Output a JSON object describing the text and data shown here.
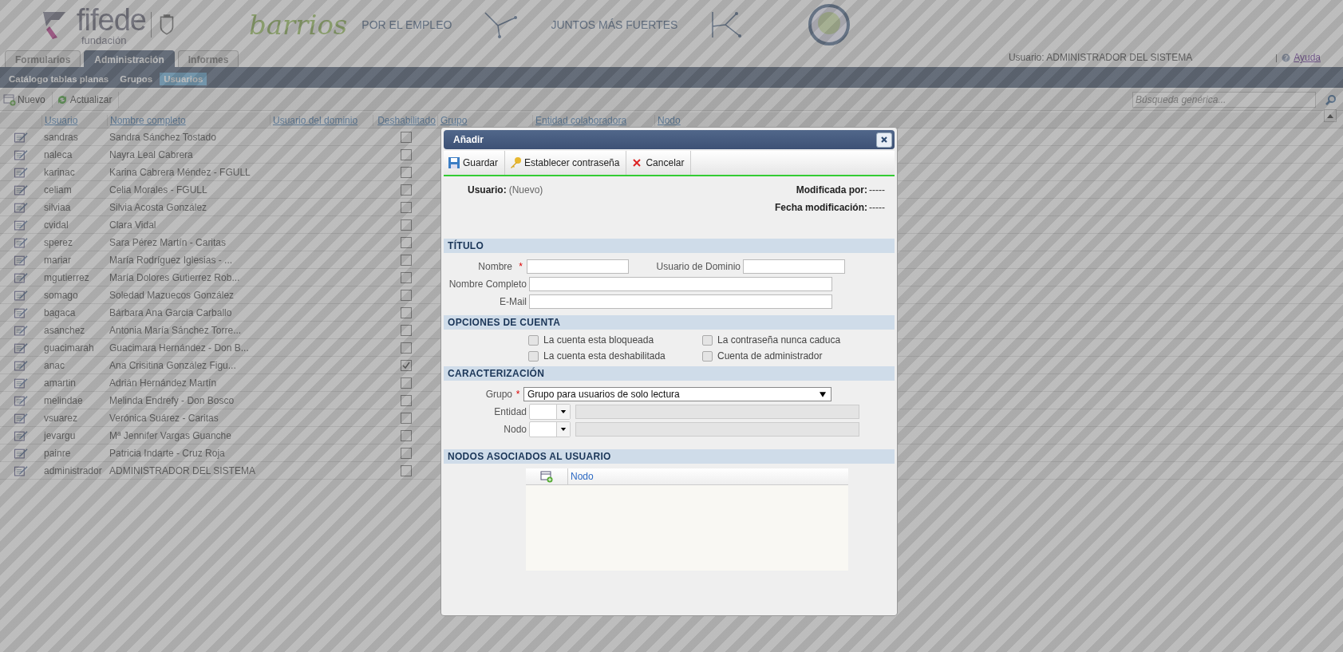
{
  "header": {
    "logo": {
      "name": "fifede",
      "subtitle": "fundación"
    },
    "banner": {
      "script": "barrios",
      "tagline_1": "POR EL EMPLEO",
      "tagline_2": "JUNTOS MÁS FUERTES"
    },
    "user_label": "Usuario: ADMINISTRADOR DEL SISTEMA",
    "help_link": "Ayuda"
  },
  "tabs": [
    {
      "label": "Formularios",
      "selected": false
    },
    {
      "label": "Administración",
      "selected": true
    },
    {
      "label": "Informes",
      "selected": false
    }
  ],
  "subnav": [
    {
      "label": "Catálogo tablas planas",
      "selected": false
    },
    {
      "label": "Grupos",
      "selected": false
    },
    {
      "label": "Usuarios",
      "selected": true
    }
  ],
  "toolbar": {
    "buttons": [
      {
        "kind": "new",
        "label": "Nuevo"
      },
      {
        "kind": "refresh",
        "label": "Actualizar"
      }
    ],
    "search": {
      "placeholder": "Búsqueda genérica..."
    }
  },
  "table": {
    "columns": [
      "Usuario",
      "Nombre completo",
      "Usuario del dominio",
      "Deshabilitado",
      "Grupo",
      "Entidad colaboradora",
      "Nodo"
    ],
    "rows": [
      {
        "usuario": "sandras",
        "nombre": "Sandra Sánchez Tostado",
        "deshabilitado": false
      },
      {
        "usuario": "naleca",
        "nombre": "Nayra Leal Cabrera",
        "deshabilitado": false
      },
      {
        "usuario": "karinac",
        "nombre": "Karina Cabrera Méndez - FGULL",
        "deshabilitado": false
      },
      {
        "usuario": "celiam",
        "nombre": "Celia Morales - FGULL",
        "deshabilitado": false
      },
      {
        "usuario": "silviaa",
        "nombre": "Silvia Acosta González",
        "deshabilitado": false
      },
      {
        "usuario": "cvidal",
        "nombre": "Clara Vidal",
        "deshabilitado": false
      },
      {
        "usuario": "sperez",
        "nombre": "Sara Pérez Martín - Caritas",
        "deshabilitado": false
      },
      {
        "usuario": "mariar",
        "nombre": "María Rodríguez Iglesias - ...",
        "deshabilitado": false
      },
      {
        "usuario": "mgutierrez",
        "nombre": "María Dolores Gutierrez Rob...",
        "deshabilitado": false
      },
      {
        "usuario": "somago",
        "nombre": "Soledad Mazuecos González",
        "deshabilitado": false
      },
      {
        "usuario": "bagaca",
        "nombre": "Bárbara Ana Garcia Carballo",
        "deshabilitado": false
      },
      {
        "usuario": "asanchez",
        "nombre": "Antonia María Sánchez Torre...",
        "deshabilitado": false
      },
      {
        "usuario": "guacimarah",
        "nombre": "Guacimara Hernández - Don B...",
        "deshabilitado": false
      },
      {
        "usuario": "anac",
        "nombre": "Ana Crisitina González Figu...",
        "deshabilitado": true
      },
      {
        "usuario": "amartin",
        "nombre": "Adrián Hernández Martín",
        "deshabilitado": false
      },
      {
        "usuario": "melindae",
        "nombre": "Melinda Endrefy - Don Bosco",
        "deshabilitado": false
      },
      {
        "usuario": "vsuarez",
        "nombre": "Verónica Suárez - Caritas",
        "deshabilitado": false
      },
      {
        "usuario": "jevargu",
        "nombre": "Mª Jennifer Vargas Guanche",
        "deshabilitado": false
      },
      {
        "usuario": "painre",
        "nombre": "Patricia Indarte - Cruz Roja",
        "deshabilitado": false
      },
      {
        "usuario": "administrador",
        "nombre": "ADMINISTRADOR DEL SISTEMA",
        "deshabilitado": false
      }
    ]
  },
  "dialog": {
    "title": "Añadir",
    "buttons": [
      {
        "kind": "save",
        "label": "Guardar"
      },
      {
        "kind": "key",
        "label": "Establecer contraseña"
      },
      {
        "kind": "cancel",
        "label": "Cancelar"
      }
    ],
    "info": {
      "usuario_label": "Usuario:",
      "usuario_value": "(Nuevo)",
      "modificada_label": "Modificada por:",
      "modificada_value": "-----",
      "fecha_label": "Fecha modificación:",
      "fecha_value": "-----"
    },
    "titulo": {
      "heading": "TÍTULO",
      "nombre": {
        "label": "Nombre",
        "required_mark": "*"
      },
      "usuario_dominio": {
        "label": "Usuario de Dominio"
      },
      "nombre_completo": {
        "label": "Nombre Completo"
      },
      "email": {
        "label": "E-Mail"
      }
    },
    "opciones": {
      "heading": "OPCIONES DE CUENTA",
      "items": [
        {
          "label": "La cuenta esta bloqueada",
          "checked": false
        },
        {
          "label": "La contraseña nunca caduca",
          "checked": false
        },
        {
          "label": "La cuenta esta deshabilitada",
          "checked": false
        },
        {
          "label": "Cuenta de administrador",
          "checked": false
        }
      ]
    },
    "caracterizacion": {
      "heading": "CARACTERIZACIÓN",
      "grupo": {
        "label": "Grupo",
        "required_mark": "*",
        "value": "Grupo para usuarios de solo lectura"
      },
      "entidad": {
        "label": "Entidad"
      },
      "nodo": {
        "label": "Nodo"
      }
    },
    "nodos": {
      "heading": "NODOS ASOCIADOS AL USUARIO",
      "column": "Nodo"
    }
  }
}
